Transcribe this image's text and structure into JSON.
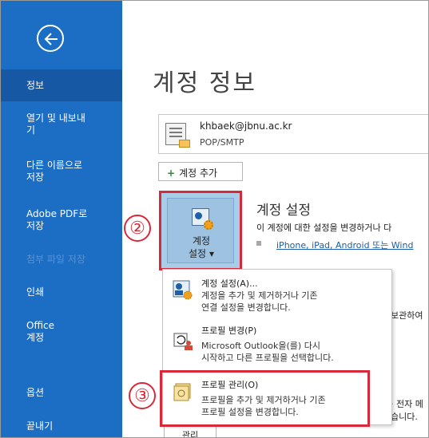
{
  "sidebar": {
    "back_icon": "arrow-left-circle-icon",
    "items": [
      {
        "label": "정보"
      },
      {
        "label": "열기 및 내보내\n기"
      },
      {
        "label": "다른 이름으로\n저장"
      },
      {
        "label": "Adobe PDF로\n저장"
      },
      {
        "label": "첨부 파일 저장"
      },
      {
        "label": "인쇄"
      },
      {
        "label": "Office\n계정"
      },
      {
        "label": "옵션"
      },
      {
        "label": "끝내기"
      }
    ]
  },
  "main": {
    "title": "계정 정보",
    "account": {
      "email": "khbaek@jbnu.ac.kr",
      "type": "POP/SMTP"
    },
    "add_account_label": "계정 추가",
    "settings_button_label_1": "계정",
    "settings_button_label_2": "설정",
    "section_title": "계정 설정",
    "section_desc": "이 계정에 대한 설정을 변경하거나 다",
    "section_link": "iPhone, iPad, Android 또는 Wind",
    "side_text_1": "보관하여",
    "side_text_2": "· 전자 메",
    "side_text_3": "습니다.",
    "bottom_button_label": "관리"
  },
  "menu": {
    "items": [
      {
        "title": "계정 설정(A)...",
        "desc_1": "계정을 추가 및 제거하거나 기존",
        "desc_2": "연결 설정을 변경합니다."
      },
      {
        "title": "프로필 변경(P)",
        "desc_1": "Microsoft Outlook을(를) 다시",
        "desc_2": "시작하고 다른 프로필을 선택합니다."
      },
      {
        "title": "프로필 관리(O)",
        "desc_1": "프로필을 추가 및 제거하거나 기존",
        "desc_2": "프로필 설정을 변경합니다."
      }
    ]
  },
  "steps": {
    "two": "②",
    "three": "③"
  },
  "colors": {
    "sidebar": "#1c6ec5",
    "sidebar_active": "#1658a3",
    "highlight_red": "#d62a3a",
    "link_blue": "#1a5da8"
  }
}
